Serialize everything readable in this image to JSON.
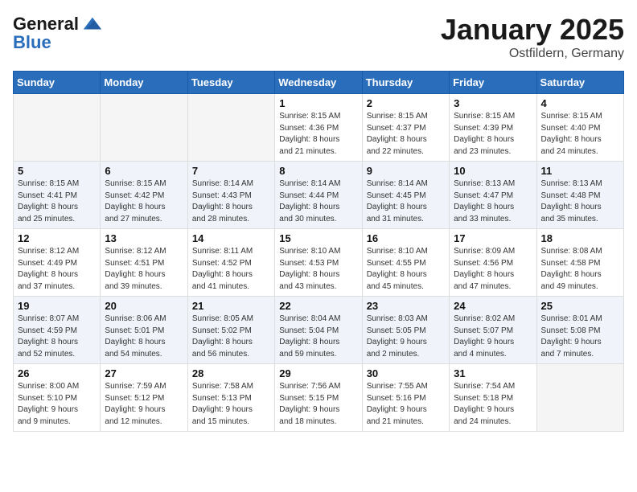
{
  "header": {
    "logo_text_general": "General",
    "logo_text_blue": "Blue",
    "month_title": "January 2025",
    "location": "Ostfildern, Germany"
  },
  "days_of_week": [
    "Sunday",
    "Monday",
    "Tuesday",
    "Wednesday",
    "Thursday",
    "Friday",
    "Saturday"
  ],
  "weeks": [
    [
      {
        "day": "",
        "info": ""
      },
      {
        "day": "",
        "info": ""
      },
      {
        "day": "",
        "info": ""
      },
      {
        "day": "1",
        "info": "Sunrise: 8:15 AM\nSunset: 4:36 PM\nDaylight: 8 hours\nand 21 minutes."
      },
      {
        "day": "2",
        "info": "Sunrise: 8:15 AM\nSunset: 4:37 PM\nDaylight: 8 hours\nand 22 minutes."
      },
      {
        "day": "3",
        "info": "Sunrise: 8:15 AM\nSunset: 4:39 PM\nDaylight: 8 hours\nand 23 minutes."
      },
      {
        "day": "4",
        "info": "Sunrise: 8:15 AM\nSunset: 4:40 PM\nDaylight: 8 hours\nand 24 minutes."
      }
    ],
    [
      {
        "day": "5",
        "info": "Sunrise: 8:15 AM\nSunset: 4:41 PM\nDaylight: 8 hours\nand 25 minutes."
      },
      {
        "day": "6",
        "info": "Sunrise: 8:15 AM\nSunset: 4:42 PM\nDaylight: 8 hours\nand 27 minutes."
      },
      {
        "day": "7",
        "info": "Sunrise: 8:14 AM\nSunset: 4:43 PM\nDaylight: 8 hours\nand 28 minutes."
      },
      {
        "day": "8",
        "info": "Sunrise: 8:14 AM\nSunset: 4:44 PM\nDaylight: 8 hours\nand 30 minutes."
      },
      {
        "day": "9",
        "info": "Sunrise: 8:14 AM\nSunset: 4:45 PM\nDaylight: 8 hours\nand 31 minutes."
      },
      {
        "day": "10",
        "info": "Sunrise: 8:13 AM\nSunset: 4:47 PM\nDaylight: 8 hours\nand 33 minutes."
      },
      {
        "day": "11",
        "info": "Sunrise: 8:13 AM\nSunset: 4:48 PM\nDaylight: 8 hours\nand 35 minutes."
      }
    ],
    [
      {
        "day": "12",
        "info": "Sunrise: 8:12 AM\nSunset: 4:49 PM\nDaylight: 8 hours\nand 37 minutes."
      },
      {
        "day": "13",
        "info": "Sunrise: 8:12 AM\nSunset: 4:51 PM\nDaylight: 8 hours\nand 39 minutes."
      },
      {
        "day": "14",
        "info": "Sunrise: 8:11 AM\nSunset: 4:52 PM\nDaylight: 8 hours\nand 41 minutes."
      },
      {
        "day": "15",
        "info": "Sunrise: 8:10 AM\nSunset: 4:53 PM\nDaylight: 8 hours\nand 43 minutes."
      },
      {
        "day": "16",
        "info": "Sunrise: 8:10 AM\nSunset: 4:55 PM\nDaylight: 8 hours\nand 45 minutes."
      },
      {
        "day": "17",
        "info": "Sunrise: 8:09 AM\nSunset: 4:56 PM\nDaylight: 8 hours\nand 47 minutes."
      },
      {
        "day": "18",
        "info": "Sunrise: 8:08 AM\nSunset: 4:58 PM\nDaylight: 8 hours\nand 49 minutes."
      }
    ],
    [
      {
        "day": "19",
        "info": "Sunrise: 8:07 AM\nSunset: 4:59 PM\nDaylight: 8 hours\nand 52 minutes."
      },
      {
        "day": "20",
        "info": "Sunrise: 8:06 AM\nSunset: 5:01 PM\nDaylight: 8 hours\nand 54 minutes."
      },
      {
        "day": "21",
        "info": "Sunrise: 8:05 AM\nSunset: 5:02 PM\nDaylight: 8 hours\nand 56 minutes."
      },
      {
        "day": "22",
        "info": "Sunrise: 8:04 AM\nSunset: 5:04 PM\nDaylight: 8 hours\nand 59 minutes."
      },
      {
        "day": "23",
        "info": "Sunrise: 8:03 AM\nSunset: 5:05 PM\nDaylight: 9 hours\nand 2 minutes."
      },
      {
        "day": "24",
        "info": "Sunrise: 8:02 AM\nSunset: 5:07 PM\nDaylight: 9 hours\nand 4 minutes."
      },
      {
        "day": "25",
        "info": "Sunrise: 8:01 AM\nSunset: 5:08 PM\nDaylight: 9 hours\nand 7 minutes."
      }
    ],
    [
      {
        "day": "26",
        "info": "Sunrise: 8:00 AM\nSunset: 5:10 PM\nDaylight: 9 hours\nand 9 minutes."
      },
      {
        "day": "27",
        "info": "Sunrise: 7:59 AM\nSunset: 5:12 PM\nDaylight: 9 hours\nand 12 minutes."
      },
      {
        "day": "28",
        "info": "Sunrise: 7:58 AM\nSunset: 5:13 PM\nDaylight: 9 hours\nand 15 minutes."
      },
      {
        "day": "29",
        "info": "Sunrise: 7:56 AM\nSunset: 5:15 PM\nDaylight: 9 hours\nand 18 minutes."
      },
      {
        "day": "30",
        "info": "Sunrise: 7:55 AM\nSunset: 5:16 PM\nDaylight: 9 hours\nand 21 minutes."
      },
      {
        "day": "31",
        "info": "Sunrise: 7:54 AM\nSunset: 5:18 PM\nDaylight: 9 hours\nand 24 minutes."
      },
      {
        "day": "",
        "info": ""
      }
    ]
  ]
}
